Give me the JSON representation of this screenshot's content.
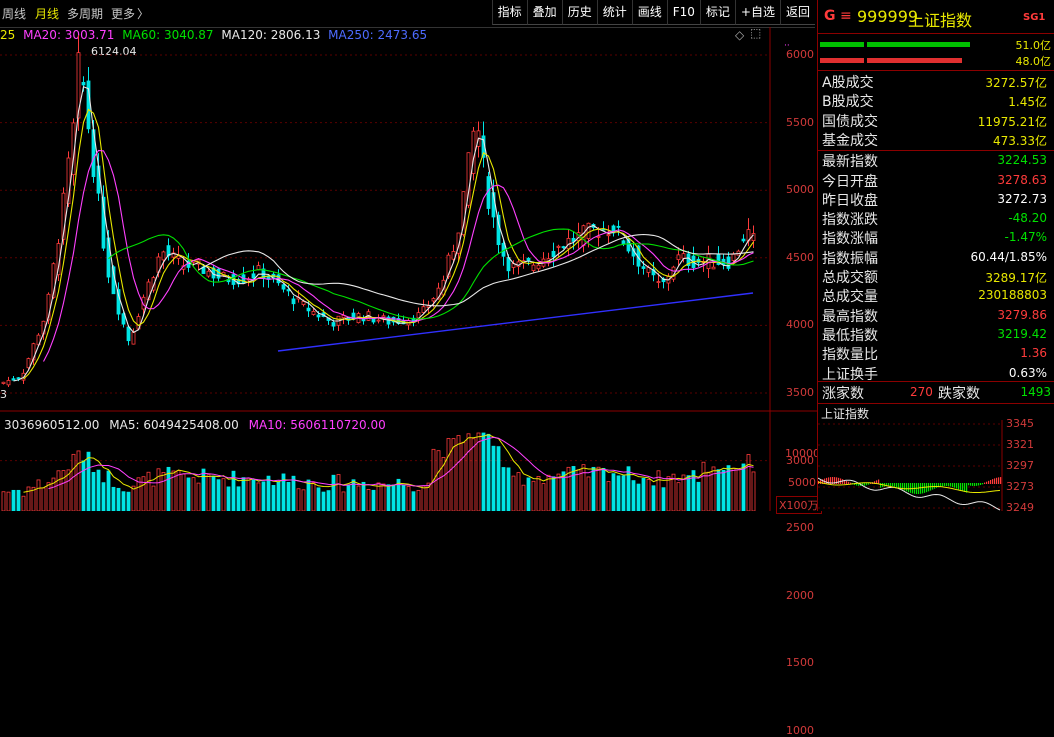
{
  "topbar": {
    "tabs": [
      {
        "label": "周线",
        "active": false
      },
      {
        "label": "月线",
        "active": true
      },
      {
        "label": "多周期",
        "active": false
      },
      {
        "label": "更多",
        "active": false
      }
    ],
    "more_arrow": "〉",
    "buttons": [
      "指标",
      "叠加",
      "历史",
      "统计",
      "画线",
      "F10",
      "标记",
      "+自选",
      "返回"
    ]
  },
  "price_legend": {
    "ma_partial": "25",
    "ma20": "MA20: 3003.71",
    "ma60": "MA60: 3040.87",
    "ma120": "MA120: 2806.13",
    "ma250": "MA250: 2473.65",
    "high_label": "6124.04",
    "left_edge_label": "3"
  },
  "price_axis": {
    "ticks": [
      "6000",
      "5500",
      "5000",
      "4500",
      "4000",
      "3500",
      "3000",
      "2500",
      "2000",
      "1500",
      "1000"
    ]
  },
  "volume_legend": {
    "vol": "3036960512.00",
    "ma5": "MA5: 6049425408.00",
    "ma10": "MA10: 5606110720.00"
  },
  "volume_axis": {
    "ticks": [
      "10000",
      "5000"
    ],
    "unit": "X100万"
  },
  "panel": {
    "badge": "G",
    "menu_icon": "≡",
    "code": "999999",
    "name": "上证指数",
    "tag": "SG1",
    "bar_up_label": "51.0亿",
    "bar_down_label": "48.0亿",
    "rows": [
      {
        "label": "A股成交",
        "value": "3272.57亿",
        "color": "#e8e800"
      },
      {
        "label": "B股成交",
        "value": "1.45亿",
        "color": "#e8e800"
      },
      {
        "label": "国债成交",
        "value": "11975.21亿",
        "color": "#e8e800"
      },
      {
        "label": "基金成交",
        "value": "473.33亿",
        "color": "#e8e800"
      },
      {
        "label": "最新指数",
        "value": "3224.53",
        "color": "#00e000"
      },
      {
        "label": "今日开盘",
        "value": "3278.63",
        "color": "#ff3b3b"
      },
      {
        "label": "昨日收盘",
        "value": "3272.73",
        "color": "#ffffff"
      },
      {
        "label": "指数涨跌",
        "value": "-48.20",
        "color": "#00e000"
      },
      {
        "label": "指数涨幅",
        "value": "-1.47%",
        "color": "#00e000"
      },
      {
        "label": "指数振幅",
        "value": "60.44/1.85%",
        "color": "#ffffff"
      },
      {
        "label": "总成交额",
        "value": "3289.17亿",
        "color": "#e8e800"
      },
      {
        "label": "总成交量",
        "value": "230188803",
        "color": "#e8e800"
      },
      {
        "label": "最高指数",
        "value": "3279.86",
        "color": "#ff3b3b"
      },
      {
        "label": "最低指数",
        "value": "3219.42",
        "color": "#00e000"
      },
      {
        "label": "指数量比",
        "value": "1.36",
        "color": "#ff3b3b"
      },
      {
        "label": "上证换手",
        "value": "0.63%",
        "color": "#ffffff"
      }
    ],
    "up_label": "涨家数",
    "up_count": "270",
    "down_label": "跌家数",
    "down_count": "1493",
    "mini_title": "上证指数",
    "mini_ticks": [
      "3345",
      "3321",
      "3297",
      "3273",
      "3249"
    ]
  }
}
